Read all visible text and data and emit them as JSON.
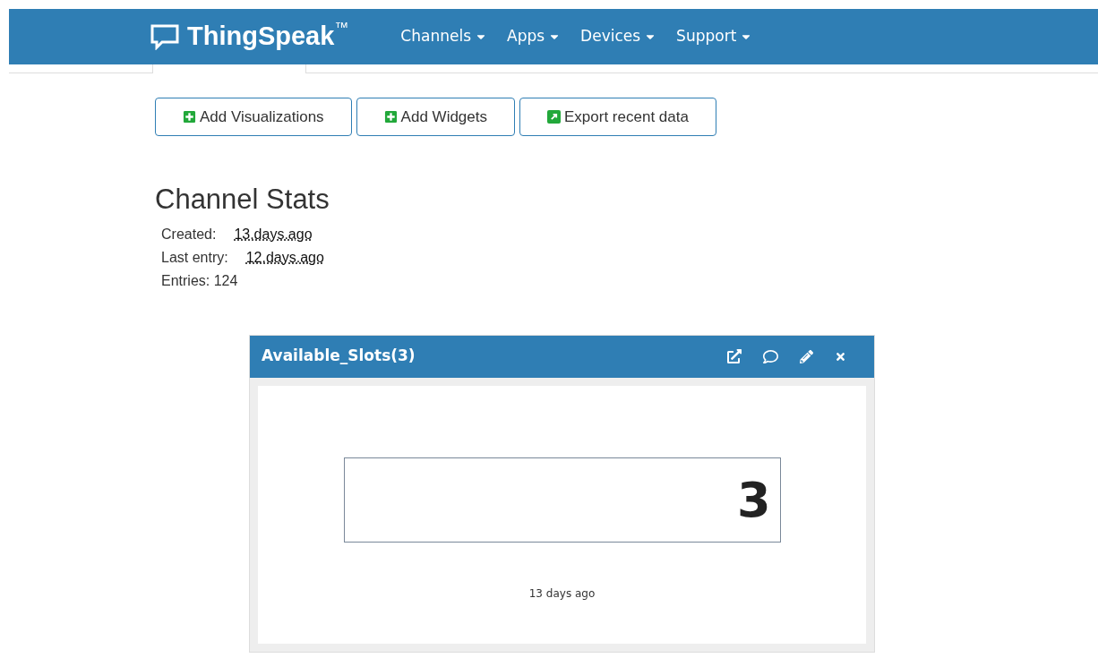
{
  "brand": {
    "name": "ThingSpeak",
    "mark": "™"
  },
  "nav": [
    {
      "label": "Channels"
    },
    {
      "label": "Apps"
    },
    {
      "label": "Devices"
    },
    {
      "label": "Support"
    }
  ],
  "actions": [
    {
      "label": "Add Visualizations",
      "kind": "add"
    },
    {
      "label": "Add Widgets",
      "kind": "add"
    },
    {
      "label": "Export recent data",
      "kind": "export"
    }
  ],
  "stats": {
    "title": "Channel Stats",
    "items": [
      {
        "label": "Created:",
        "value": "13.days.ago",
        "kind": "time"
      },
      {
        "label": "Last entry:",
        "value": "12.days.ago",
        "kind": "time"
      },
      {
        "label": "Entries: 124",
        "kind": "plain"
      }
    ]
  },
  "widget": {
    "title": "Available_Slots(3)",
    "value": "3",
    "updated": "13 days ago"
  }
}
